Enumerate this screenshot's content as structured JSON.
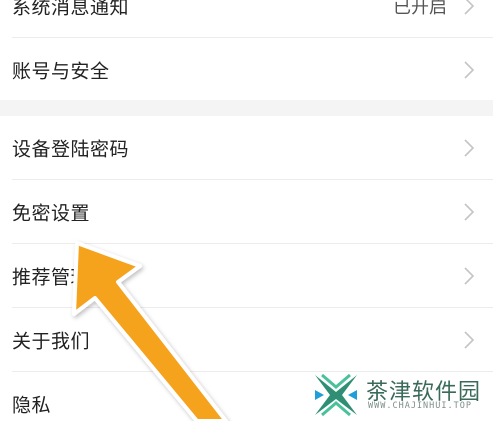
{
  "settings": {
    "rows": [
      {
        "label": "系统消息通知",
        "value": "已开启"
      },
      {
        "label": "账号与安全"
      },
      {
        "label": "设备登陆密码"
      },
      {
        "label": "免密设置"
      },
      {
        "label": "推荐管理"
      },
      {
        "label": "关于我们"
      },
      {
        "label": "隐私"
      }
    ]
  },
  "icons": {
    "chevron": "chevron-right-icon",
    "pointer": "orange-arrow-pointer"
  },
  "colors": {
    "arrow": "#F5A21B",
    "arrow_stroke": "#ffffff",
    "watermark": "#3a6a58"
  },
  "watermark": {
    "title": "茶津软件园",
    "url": "WWW.CHAJINHUI.TOP"
  }
}
